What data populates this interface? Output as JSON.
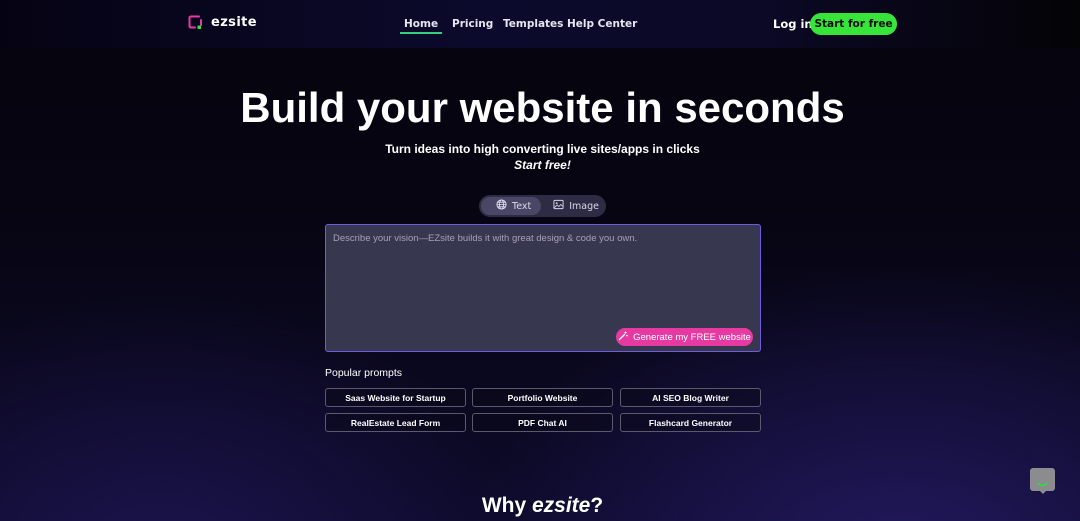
{
  "header": {
    "logo_text": "ezsite",
    "nav": [
      {
        "label": "Home",
        "active": true
      },
      {
        "label": "Pricing",
        "active": false
      },
      {
        "label": "Templates",
        "active": false
      },
      {
        "label": "Help Center",
        "active": false
      }
    ],
    "login_label": "Log in",
    "cta_label": "Start for free"
  },
  "hero": {
    "title": "Build your website in seconds",
    "subtitle": "Turn ideas into high converting live sites/apps in clicks",
    "subtitle_emphasis": "Start free!"
  },
  "mode_toggle": {
    "options": [
      {
        "label": "Text",
        "icon": "globe-icon",
        "active": true
      },
      {
        "label": "Image",
        "icon": "image-icon",
        "active": false
      }
    ]
  },
  "prompt": {
    "placeholder": "Describe your vision—EZsite builds it with great design & code you own.",
    "value": "",
    "generate_label": "Generate my FREE website"
  },
  "popular_prompts": {
    "title": "Popular prompts",
    "items": [
      "Saas Website for Startup",
      "Portfolio Website",
      "AI SEO Blog Writer",
      "RealEstate Lead Form",
      "PDF Chat AI",
      "Flashcard Generator"
    ]
  },
  "why": {
    "prefix": "Why ",
    "brand": "ezsite",
    "suffix": "?"
  },
  "colors": {
    "accent_green": "#37e43a",
    "accent_pink": "#e63aa2",
    "accent_purple": "#6e5ce0",
    "logo_pink": "#e63aa2",
    "logo_green": "#37e43a"
  }
}
